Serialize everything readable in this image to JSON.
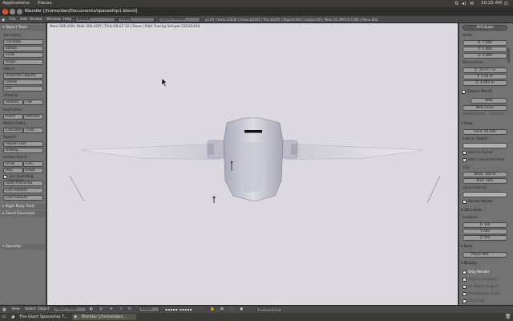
{
  "os_panel": {
    "menus": [
      "Applications",
      "Places"
    ],
    "clock": "10:25 AM",
    "icons": [
      "network-icon",
      "speaker-icon",
      "mail-icon",
      "power-icon"
    ]
  },
  "window": {
    "title": "Blender [/home/dan/Documents/spaceship1.blend]"
  },
  "info_header": {
    "menus": [
      "File",
      "Add",
      "Render",
      "Window",
      "Help"
    ],
    "screen_layout": "Default",
    "scene": "Scene",
    "engine": "Cycles Render",
    "stats": "v2.69 | Verts:23230 | Faces:43292 | Tris:43292 | Objects:0/4 | Lamps:0/0 | Mem:16.38M (0.11M) | Plane.002"
  },
  "viewport": {
    "render_status": "Mem:306.42M, Peak:306.42M | Time:00:07.10 | Done | Path Tracing Sample 1443/1444"
  },
  "toolshelf": {
    "header": "Object Tools",
    "sections": {
      "transform": "Transform:",
      "object": "Object:",
      "shading": "Shading:",
      "keyframes": "Keyframes:",
      "motion_paths": "Motion Paths:",
      "repeat": "Repeat:",
      "grease_pencil": "Grease Pencil:"
    },
    "buttons": {
      "translate": "Translate",
      "rotate": "Rotate",
      "scale": "Scale",
      "origin": "Origin",
      "duplicate": "Duplicate Objects",
      "delete": "Delete",
      "join": "Join",
      "smooth": "Smooth",
      "flat": "Flat",
      "insert": "Insert",
      "remove": "Remove",
      "calc_paths": "Calculate",
      "clear_paths": "Clear",
      "repeat_last": "Repeat Last",
      "history": "History...",
      "draw": "Draw",
      "line": "Line",
      "poly": "Poly",
      "erase": "Erase",
      "ruler": "Ruler/Protractor",
      "cell_fracture": "Cell Fracture",
      "cell_fracture2": "Cell Fracture"
    },
    "use_sketching": "Use Sketching Sessions",
    "collapsed_panels": [
      "Rigid Body Tools",
      "Cloud Generator"
    ],
    "operator_header": "Operator"
  },
  "properties": {
    "scale_label": "Scale:",
    "scale": {
      "x": "X: 1.000",
      "y": "Y: 1.000",
      "z": "Z: 1.000"
    },
    "dimensions_label": "Dimensions:",
    "dimensions": {
      "x": "X: 10.077 m",
      "y": "Y: 1.54 m",
      "z": "Z: 4.093 m"
    },
    "mode": "XYZ Euler",
    "grease_pencil": {
      "title": "Grease Pencil",
      "new": "New",
      "new_layer": "New Layer",
      "delete_frame": "Delete Frame",
      "convert": "Convert"
    },
    "view": {
      "title": "View",
      "lens": "Lens: 35.000",
      "lock_to_object": "Lock to Object:",
      "lock_to_cursor": "Lock to Cursor",
      "lock_camera": "Lock Camera to View",
      "clip": "Clip:",
      "clip_start": "Start: 100 m",
      "clip_end": "End: 1km",
      "local_camera": "Local Camera:",
      "render_border": "Render Border"
    },
    "cursor": {
      "title": "3D Cursor",
      "location": "Location:",
      "x": "X: 0m",
      "y": "Y: 0m",
      "z": "Z: 0m"
    },
    "item": {
      "title": "Item",
      "name": "Plane.005"
    },
    "display": {
      "title": "Display",
      "only_render": "Only Render",
      "outline_selected": "Outline Selected",
      "all_object_origins": "All Object Origins",
      "relationship_lines": "Relationship Lines",
      "grid_floor": "Grid Floor"
    }
  },
  "vp_header": {
    "menus": [
      "View",
      "Select",
      "Object"
    ],
    "mode": "Object Mode",
    "pivot": "Global",
    "layer": "RenderLayer"
  },
  "taskbar": {
    "tasks": [
      "The Giant Spaceship T...",
      "Blender [/home/dan/..."
    ]
  },
  "colors": {
    "viewport_bg": "#ddd8e0",
    "panel_bg": "#727272",
    "header_bg": "#4a4a4a",
    "os_panel_bg": "#3c3b37",
    "accent": "#5680c2"
  }
}
